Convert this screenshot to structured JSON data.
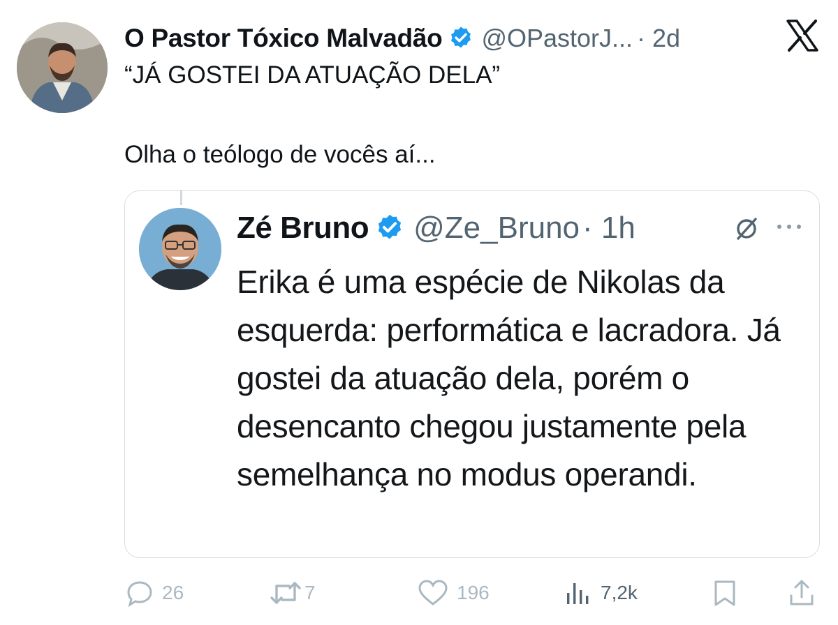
{
  "tweet": {
    "author_name": "O Pastor Tóxico Malvadão",
    "handle": "@OPastorJ...",
    "time": "· 2d",
    "lines": [
      "“JÁ GOSTEI DA ATUAÇÃO DELA”",
      "Olha o teólogo de vocês aí..."
    ]
  },
  "quoted": {
    "author_name": "Zé Bruno",
    "handle": "@Ze_Bruno",
    "time": "· 1h",
    "text": "Erika é uma espécie de Nikolas da esquerda: performática e lacradora. Já gostei da atuação dela, porém o desencanto chegou justamente pela semelhança no modus operandi."
  },
  "actions": {
    "replies": "26",
    "retweets": "7",
    "likes": "196",
    "views": "7,2k"
  },
  "icons": {
    "verified": "verified-badge-icon",
    "x_logo": "x-logo-icon",
    "grok": "grok-icon",
    "more": "more-icon",
    "reply": "reply-icon",
    "retweet": "retweet-icon",
    "like": "like-icon",
    "views": "views-icon",
    "bookmark": "bookmark-icon",
    "share": "share-icon"
  },
  "colors": {
    "verified_blue": "#1d9bf0",
    "muted_gray": "#536471",
    "action_gray": "#aab8c2"
  }
}
